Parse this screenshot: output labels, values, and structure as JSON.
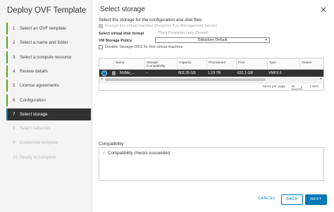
{
  "wizard": {
    "title": "Deploy OVF Template",
    "steps": [
      {
        "num": "1",
        "label": "Select an OVF template",
        "state": "done"
      },
      {
        "num": "2",
        "label": "Select a name and folder",
        "state": "done"
      },
      {
        "num": "3",
        "label": "Select a compute resource",
        "state": "done"
      },
      {
        "num": "4",
        "label": "Review details",
        "state": "done"
      },
      {
        "num": "5",
        "label": "License agreements",
        "state": "done"
      },
      {
        "num": "6",
        "label": "Configuration",
        "state": "done"
      },
      {
        "num": "7",
        "label": "Select storage",
        "state": "active"
      },
      {
        "num": "8",
        "label": "Select networks",
        "state": "disabled"
      },
      {
        "num": "9",
        "label": "Customize template",
        "state": "disabled"
      },
      {
        "num": "10",
        "label": "Ready to complete",
        "state": "disabled"
      }
    ]
  },
  "main": {
    "heading": "Select storage",
    "close_icon": "✕",
    "subtitle": "Select the storage for the configuration and disk files",
    "encrypt_label": "Encrypt this virtual machine (Requires Key Management Server)",
    "disk_format_label": "Select virtual disk format",
    "disk_format_value": "Thick Provision Lazy Zeroed",
    "policy_label": "VM Storage Policy",
    "policy_value": "Datastore Default",
    "disable_drs_label": "Disable Storage DRS for this virtual machine"
  },
  "grid": {
    "columns": [
      "Name",
      "Storage Compatibility",
      "Capacity",
      "Provisioned",
      "Free",
      "Type",
      "Cluster"
    ],
    "rows": [
      {
        "name": "NVMe_...",
        "compatibility": "--",
        "capacity": "803.25 GB",
        "provisioned": "1.19 TB",
        "free": "632.1 GB",
        "type": "VMFS 6",
        "cluster": ""
      }
    ],
    "footer": {
      "items_per_page_label": "Items per page",
      "items_per_page_value": "10",
      "count_label": "1 item"
    }
  },
  "compatibility": {
    "label": "Compatibility",
    "message": "Compatibility checks succeeded."
  },
  "buttons": {
    "cancel": "CANCEL",
    "back": "BACK",
    "next": "NEXT"
  },
  "colors": {
    "accent": "#0079b8",
    "selected_row": "#313131",
    "success": "#5aa220"
  }
}
